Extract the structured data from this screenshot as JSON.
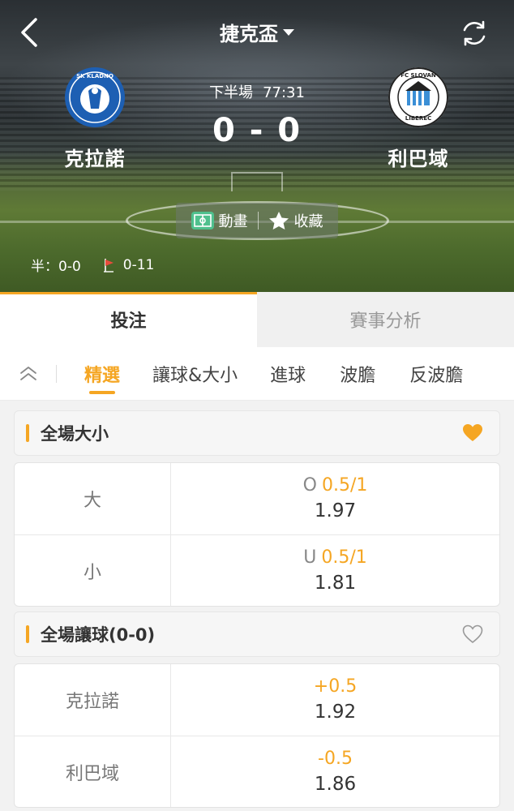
{
  "header": {
    "title": "捷克盃",
    "match_status": "下半場",
    "match_clock": "77:31",
    "score": "0 - 0",
    "home_team": {
      "name": "克拉諾",
      "crest_text": "SK KLADNO"
    },
    "away_team": {
      "name": "利巴域",
      "crest_text_top": "FC SLOVAN",
      "crest_text_bottom": "LIBEREC"
    },
    "actions": {
      "animation_label": "動畫",
      "favorite_label": "收藏"
    },
    "half_time_score": "半：0-0",
    "corners": "0-11"
  },
  "main_tabs": [
    {
      "label": "投注",
      "active": true
    },
    {
      "label": "賽事分析",
      "active": false
    }
  ],
  "sub_tabs": [
    {
      "label": "精選",
      "active": true
    },
    {
      "label": "讓球&大小",
      "active": false
    },
    {
      "label": "進球",
      "active": false
    },
    {
      "label": "波膽",
      "active": false
    },
    {
      "label": "反波膽",
      "active": false
    }
  ],
  "markets": [
    {
      "title": "全場大小",
      "favorited": true,
      "rows": [
        {
          "name": "大",
          "prefix": "O",
          "line": "0.5/1",
          "price": "1.97"
        },
        {
          "name": "小",
          "prefix": "U",
          "line": "0.5/1",
          "price": "1.81"
        }
      ]
    },
    {
      "title": "全場讓球(0-0)",
      "favorited": false,
      "rows": [
        {
          "name": "克拉諾",
          "prefix": "",
          "line": "+0.5",
          "price": "1.92"
        },
        {
          "name": "利巴域",
          "prefix": "",
          "line": "-0.5",
          "price": "1.86"
        }
      ]
    }
  ],
  "colors": {
    "accent": "#f5a623",
    "text": "#333333",
    "muted": "#777777"
  }
}
